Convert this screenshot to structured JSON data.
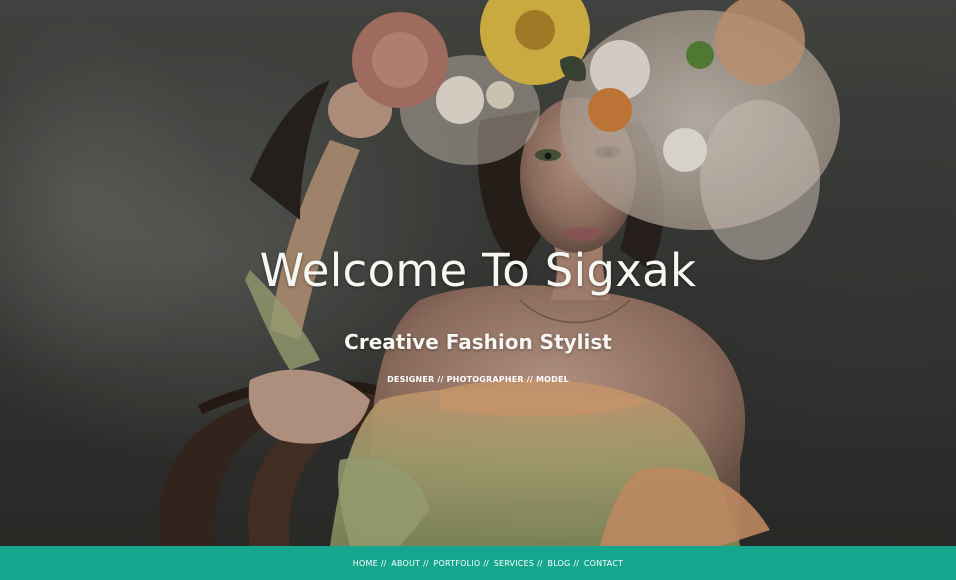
{
  "hero": {
    "title": "Welcome To Sigxak",
    "subtitle": "Creative Fashion Stylist",
    "tagline": "DESIGNER // PHOTOGRAPHER // MODEL"
  },
  "nav": {
    "separator": "//",
    "items": [
      {
        "label": "HOME"
      },
      {
        "label": "ABOUT"
      },
      {
        "label": "PORTFOLIO"
      },
      {
        "label": "SERVICES"
      },
      {
        "label": "BLOG"
      },
      {
        "label": "CONTACT"
      }
    ]
  },
  "colors": {
    "nav_background": "#16a68d",
    "text": "#ffffff"
  }
}
